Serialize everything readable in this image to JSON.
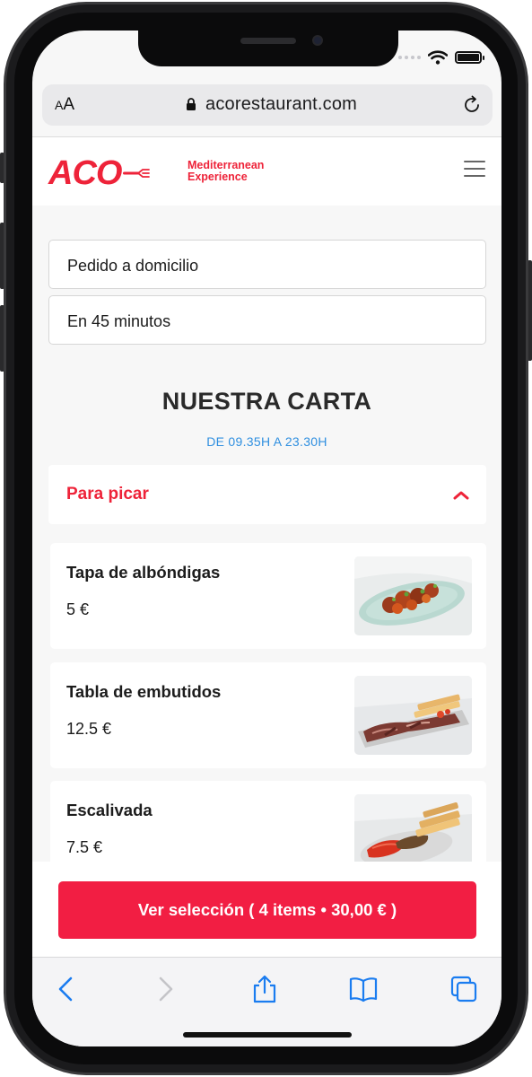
{
  "browser": {
    "text_size_label": "AA",
    "url": "acorestaurant.com"
  },
  "site": {
    "logo_text": "ACO",
    "tagline_line1": "Mediterranean",
    "tagline_line2": "Experience",
    "brand_color": "#ee2339"
  },
  "order": {
    "delivery_mode": "Pedido a domicilio",
    "delivery_time": "En 45 minutos"
  },
  "menu": {
    "title": "NUESTRA CARTA",
    "hours": "DE 09.35H A 23.30H",
    "category": "Para picar",
    "items": [
      {
        "name": "Tapa de albóndigas",
        "price": "5 €"
      },
      {
        "name": "Tabla de embutidos",
        "price": "12.5 €"
      },
      {
        "name": "Escalivada",
        "price": "7.5 €"
      }
    ]
  },
  "cart": {
    "button_label": "Ver selección ( 4 items • 30,00 € )",
    "button_color": "#f21e43"
  },
  "toolbar": {
    "icons": [
      "chevron-left-icon",
      "chevron-right-icon",
      "share-icon",
      "bookmarks-icon",
      "tabs-icon"
    ]
  }
}
